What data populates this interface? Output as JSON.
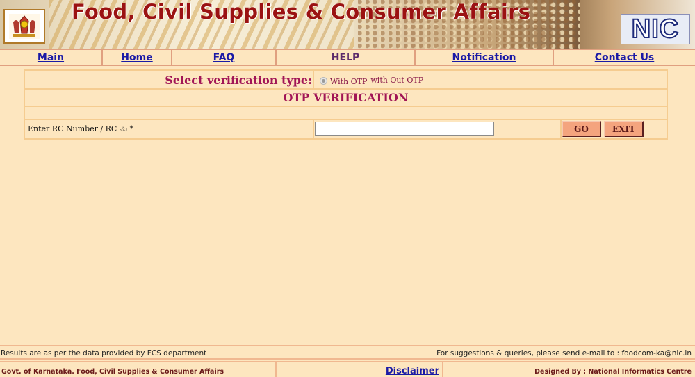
{
  "header": {
    "title": "Food, Civil Supplies & Consumer Affairs",
    "nic_logo_text": "NIC"
  },
  "nav": {
    "items": [
      {
        "label": "Main",
        "link": true
      },
      {
        "label": "Home",
        "link": true
      },
      {
        "label": "FAQ",
        "link": true
      },
      {
        "label": "HELP",
        "link": false
      },
      {
        "label": "Notification",
        "link": true
      },
      {
        "label": "Contact Us",
        "link": true
      }
    ]
  },
  "form": {
    "verification_label": "Select verification type:",
    "option_with_otp": "With OTP",
    "option_without_otp": "with Out OTP",
    "otp_title": "OTP VERIFICATION",
    "rc_label": "Enter RC Number  / RC ನಂ *",
    "rc_value": "",
    "go_label": "GO",
    "exit_label": "EXIT"
  },
  "footer": {
    "data_note": "Results are as per the data provided by FCS department",
    "contact_note": "For suggestions & queries, please send e-mail to : foodcom-ka@nic.in",
    "govt": "Govt. of Karnataka. Food, Civil Supplies & Consumer Affairs",
    "disclaimer": "Disclaimer",
    "designed_by": "Designed By : National Informatics Centre"
  },
  "colors": {
    "page_bg": "#fde6bf",
    "title_red": "#9b1212",
    "link_blue": "#1a1aa6",
    "form_heading": "#a11556",
    "button_bg": "#f4a47e"
  }
}
